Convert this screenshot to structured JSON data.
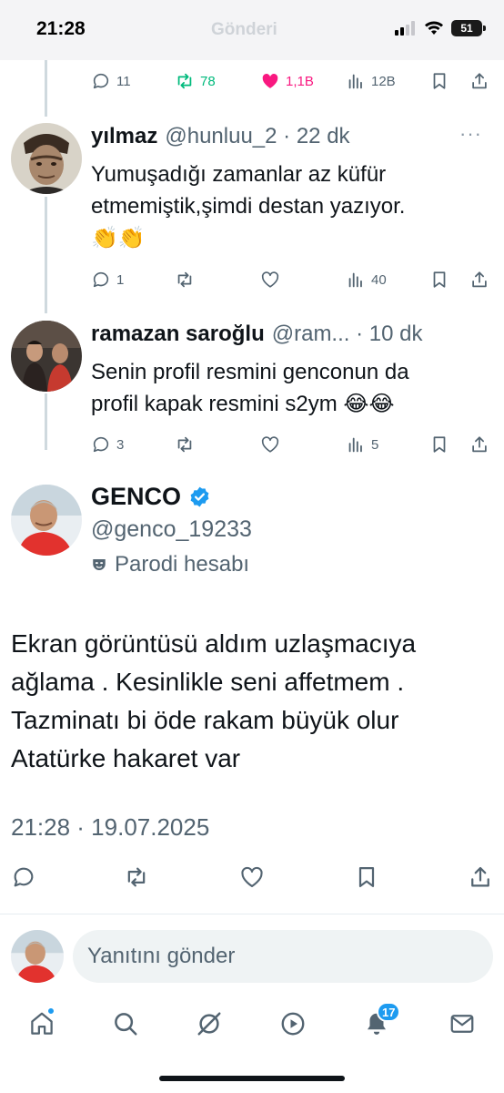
{
  "status_bar": {
    "time": "21:28",
    "faded_title": "Gönderi",
    "battery": "51"
  },
  "top_actions": {
    "replies": "11",
    "reposts": "78",
    "likes": "1,1B",
    "views": "12B",
    "repost_color": "#00ba7c",
    "like_color": "#f91880"
  },
  "replies": [
    {
      "name": "yılmaz",
      "handle": "@hunluu_2",
      "time": "22 dk",
      "meta": "@hunluu_2 · 22 dk",
      "text_line1": "Yumuşadığı  zamanlar az küfür",
      "text_line2": "etmemiştik,şimdi destan yazıyor.",
      "emoji": "👏👏",
      "replies": "1",
      "reposts": "",
      "likes": "",
      "views": "40"
    },
    {
      "name": "ramazan saroğlu",
      "handle": "@ram...",
      "time": "10 dk",
      "meta": "@ram... · 10 dk",
      "text_line1": "Senin profil resmini genconun da",
      "text_line2": "profil kapak resmini s2ym 😂😂",
      "replies": "3",
      "reposts": "",
      "likes": "",
      "views": "5"
    }
  ],
  "main_tweet": {
    "name": "GENCO",
    "handle": "@genco_19233",
    "parody_label": "Parodi hesabı",
    "text_line1": "Ekran görüntüsü aldım uzlaşmacıya",
    "text_line2": "ağlama . Kesinlikle seni affetmem .",
    "text_line3": "Tazminatı bi öde rakam büyük olur",
    "text_line4": "Atatürke hakaret var",
    "timestamp": "21:28 · 19.07.2025",
    "verified_color": "#1d9bf0"
  },
  "composer": {
    "placeholder": "Yanıtını gönder"
  },
  "bottom_nav": {
    "notifications_badge": "17",
    "items": [
      "home-icon",
      "search-icon",
      "grok-icon",
      "video-icon",
      "bell-icon",
      "mail-icon"
    ]
  }
}
